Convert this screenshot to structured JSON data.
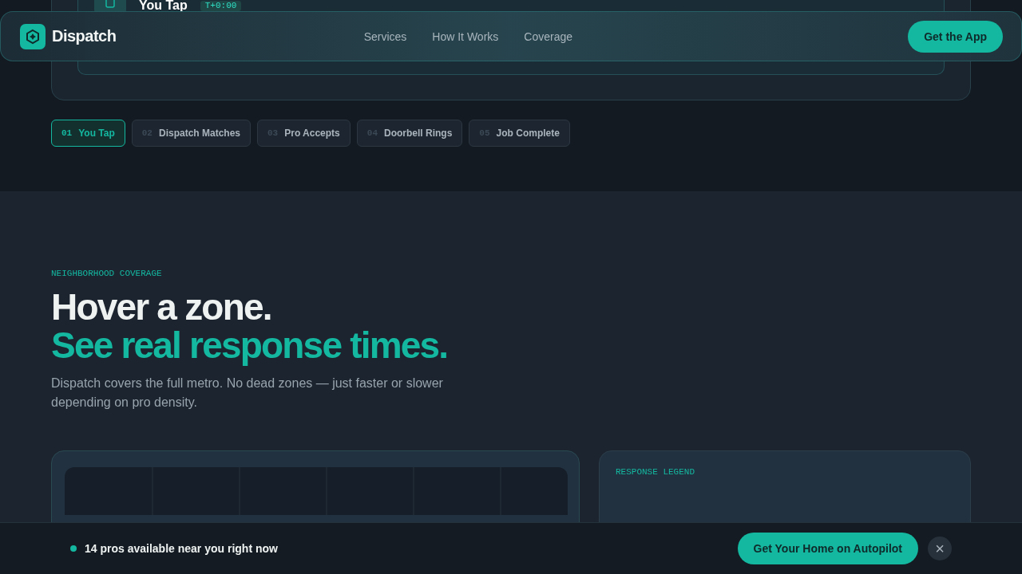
{
  "nav": {
    "brand": "Dispatch",
    "links": [
      "Services",
      "How It Works",
      "Coverage"
    ],
    "cta": "Get the App"
  },
  "step_card": {
    "title": "You Tap",
    "time": "T+0:00"
  },
  "steps": [
    {
      "number": "01",
      "label": "You Tap",
      "selected": true
    },
    {
      "number": "02",
      "label": "Dispatch Matches",
      "selected": false
    },
    {
      "number": "03",
      "label": "Pro Accepts",
      "selected": false
    },
    {
      "number": "04",
      "label": "Doorbell Rings",
      "selected": false
    },
    {
      "number": "05",
      "label": "Job Complete",
      "selected": false
    }
  ],
  "coverage": {
    "eyebrow": "NEIGHBORHOOD COVERAGE",
    "headline": "Hover a zone.",
    "headline_accent": "See real response times.",
    "body": "Dispatch covers the full metro. No dead zones — just faster or slower depending on pro density.",
    "legend_title": "RESPONSE LEGEND"
  },
  "banner": {
    "status": "14 pros available near you right now",
    "live": true,
    "cta": "Get Your Home on Autopilot",
    "close": "×"
  }
}
